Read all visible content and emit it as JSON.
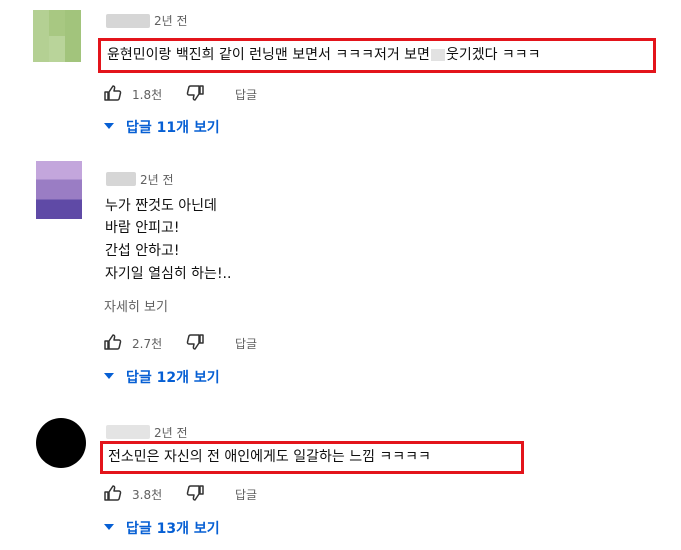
{
  "comments": [
    {
      "time": "2년 전",
      "text_before": "윤현민이랑 백진희 같이 런닝맨 보면서 ㅋㅋㅋ저거 보면",
      "text_after": "웃기겠다 ㅋㅋㅋ",
      "likes": "1.8천",
      "reply_label": "답글",
      "replies": "답글 11개 보기"
    },
    {
      "time": "2년 전",
      "lines": [
        "누가 짠것도 아닌데",
        "바람 안피고!",
        "간섭 안하고!",
        "자기일 열심히 하는!.."
      ],
      "read_more": "자세히 보기",
      "likes": "2.7천",
      "reply_label": "답글",
      "replies": "답글 12개 보기"
    },
    {
      "time": "2년 전",
      "text": "전소민은 자신의 전 애인에게도 일갈하는 느낌 ㅋㅋㅋㅋ",
      "likes": "3.8천",
      "reply_label": "답글",
      "replies": "답글 13개 보기"
    }
  ],
  "colors": {
    "highlight": "#e3141b",
    "link": "#065fd4",
    "meta": "#606060"
  },
  "icons": [
    "thumb-up-icon",
    "thumb-down-icon",
    "caret-down-icon"
  ]
}
